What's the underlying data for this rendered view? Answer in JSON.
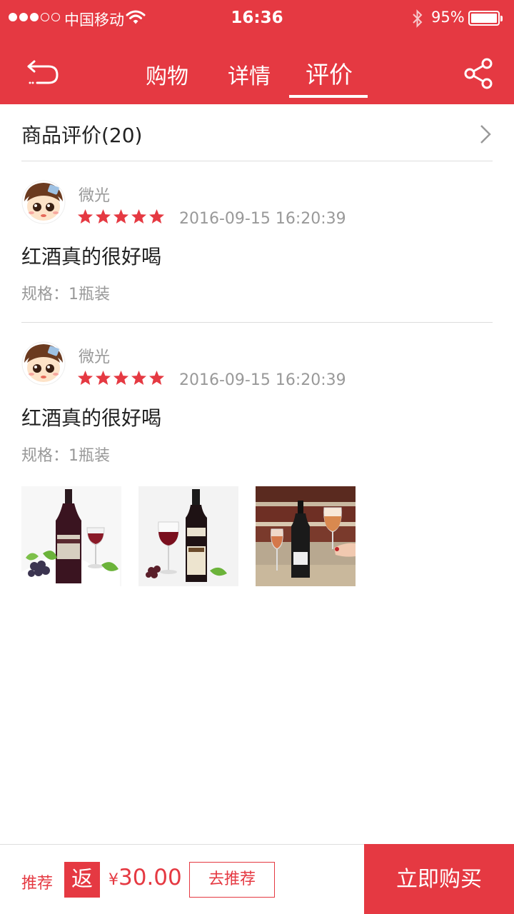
{
  "status_bar": {
    "carrier": "中国移动",
    "time": "16:36",
    "battery": "95%",
    "signal_dots": 5,
    "signal_filled": 3
  },
  "nav": {
    "tabs": [
      {
        "label": "购物",
        "active": false
      },
      {
        "label": "详情",
        "active": false
      },
      {
        "label": "评价",
        "active": true
      }
    ],
    "back_icon": "back-icon",
    "share_icon": "share-icon"
  },
  "section": {
    "title": "商品评价(20)"
  },
  "reviews": [
    {
      "username": "微光",
      "rating": 5,
      "date": "2016-09-15 16:20:39",
      "content": "红酒真的很好喝",
      "spec": "规格：1瓶装",
      "photos": []
    },
    {
      "username": "微光",
      "rating": 5,
      "date": "2016-09-15 16:20:39",
      "content": "红酒真的很好喝",
      "spec": "规格：1瓶装",
      "photos": [
        "wine-photo-1",
        "wine-photo-2",
        "wine-photo-3"
      ]
    }
  ],
  "bottom_bar": {
    "recommend_label": "推荐",
    "rebate_badge": "返",
    "price_symbol": "¥",
    "price": "30.00",
    "go_recommend_label": "去推荐",
    "buy_now_label": "立即购买"
  },
  "colors": {
    "brand_red": "#e53942",
    "muted_text": "#999999",
    "divider": "#dddddd"
  }
}
